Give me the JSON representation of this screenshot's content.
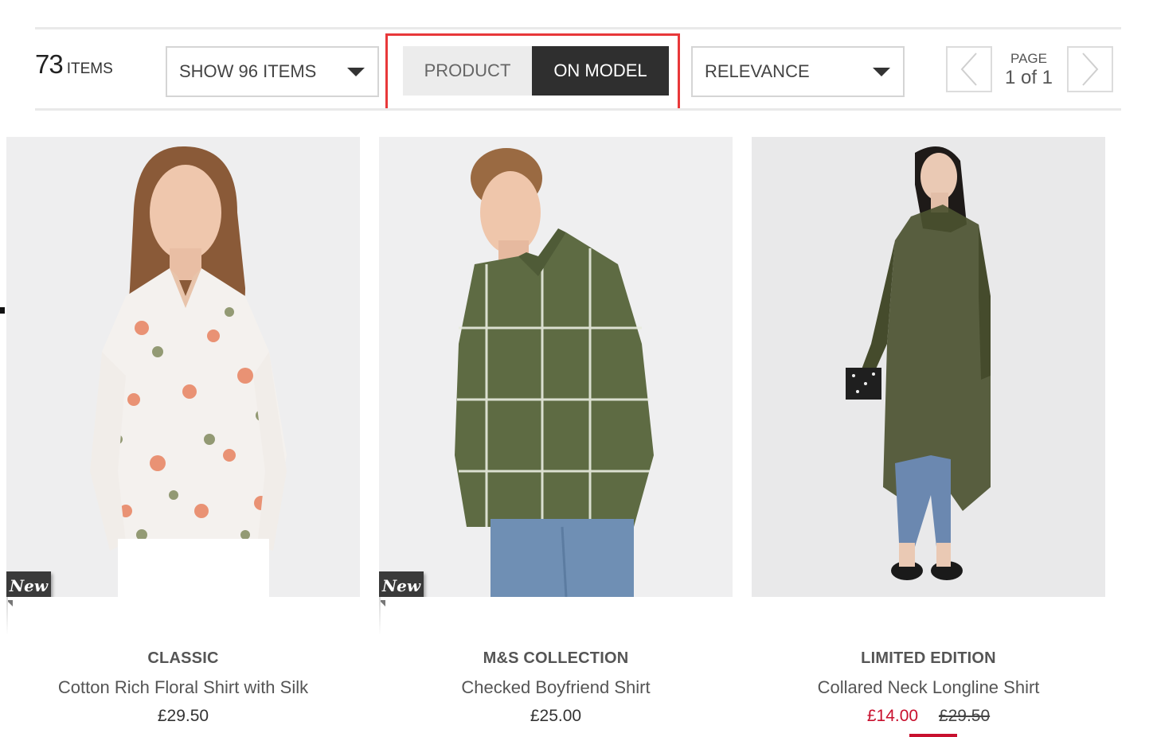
{
  "toolbar": {
    "item_count": "73",
    "item_label": "ITEMS",
    "show_select_value": "SHOW 96 ITEMS",
    "view_toggle": {
      "product_label": "PRODUCT",
      "on_model_label": "ON MODEL",
      "active": "ON MODEL"
    },
    "sort_select_value": "RELEVANCE",
    "pagination": {
      "page_label": "PAGE",
      "page_value": "1 of 1"
    },
    "highlight_color": "#e8383a"
  },
  "products": [
    {
      "brand": "CLASSIC",
      "name": "Cotton Rich Floral Shirt with Silk",
      "price": "£29.50",
      "badge": "New"
    },
    {
      "brand": "M&S COLLECTION",
      "name": "Checked Boyfriend Shirt",
      "price": "£25.00",
      "badge": "New"
    },
    {
      "brand": "LIMITED EDITION",
      "name": "Collared Neck Longline Shirt",
      "sale_price": "£14.00",
      "was_price": "£29.50"
    }
  ],
  "colors": {
    "sale_red": "#c8102e",
    "toggle_active_bg": "#2f2f2f",
    "toggle_inactive_bg": "#ececec"
  }
}
